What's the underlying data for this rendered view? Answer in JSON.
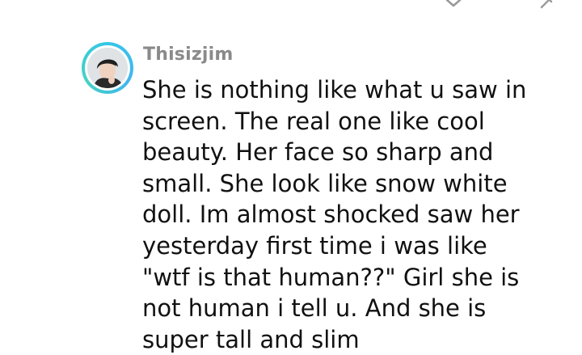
{
  "icons": {
    "expand": "chevron-down-icon",
    "edit": "pencil-icon"
  },
  "comment": {
    "username": "Thisizjim",
    "avatar": "profile-avatar",
    "text_lines": [
      "She is nothing like what u saw in",
      "screen. The real one like cool",
      "beauty. Her face so sharp and",
      "small. She look like snow white",
      "doll. Im almost shocked saw her",
      "yesterday first time i was like",
      "\"wtf is that human??\" Girl she is",
      "not human i tell u. And she is",
      "super tall and slim"
    ]
  },
  "colors": {
    "avatar_ring": "#36c6e6",
    "username": "#8a8a8a",
    "text": "#111111"
  }
}
